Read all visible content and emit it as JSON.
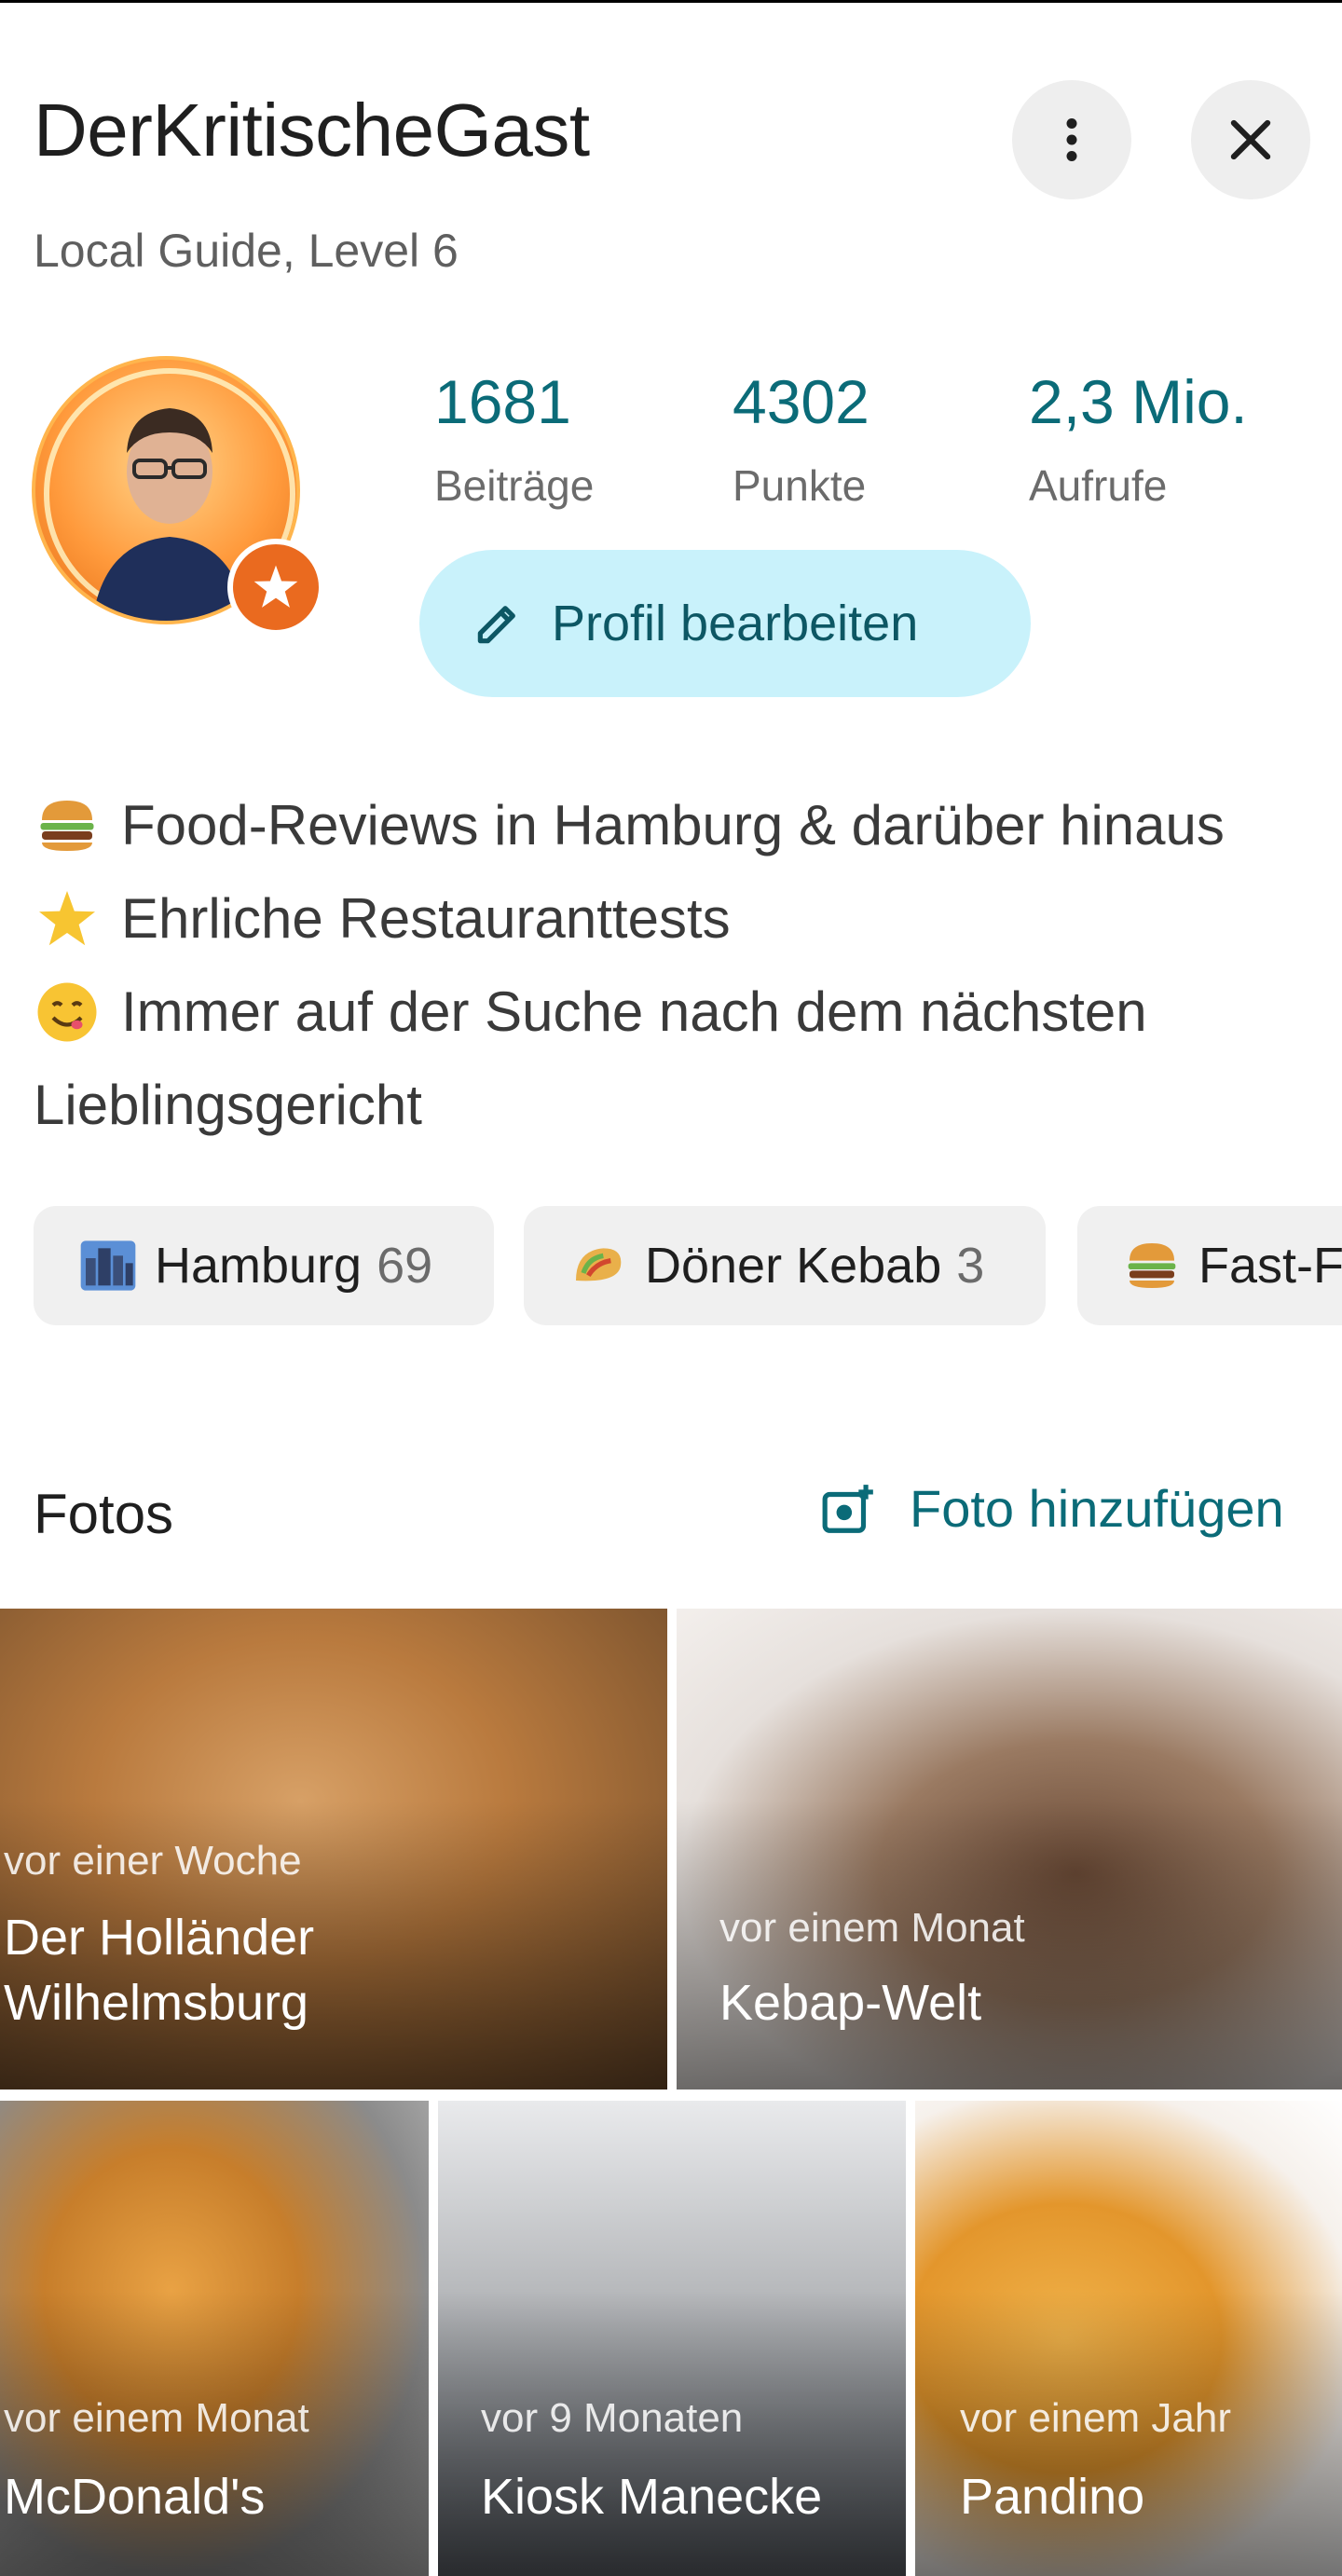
{
  "profile": {
    "name": "DerKritischeGast",
    "subtitle": "Local Guide, Level 6"
  },
  "actions": {
    "more": "more-vert-icon",
    "close": "close-icon"
  },
  "stats": [
    {
      "value": "1681",
      "label": "Beiträge"
    },
    {
      "value": "4302",
      "label": "Punkte"
    },
    {
      "value": "2,3 Mio.",
      "label": "Aufrufe"
    }
  ],
  "edit_profile": {
    "label": "Profil bearbeiten",
    "icon": "pencil-icon"
  },
  "bio": [
    {
      "emoji": "burger",
      "text": "Food-Reviews in Hamburg & darüber hinaus"
    },
    {
      "emoji": "star",
      "text": "Ehrliche Restauranttests"
    },
    {
      "emoji": "yum-face",
      "text": "Immer auf der Suche nach dem nächsten"
    },
    {
      "emoji": "",
      "text": "Lieblingsgericht"
    }
  ],
  "chips": [
    {
      "emoji": "city",
      "label": "Hamburg",
      "count": "69"
    },
    {
      "emoji": "taco",
      "label": "Döner Kebab",
      "count": "3"
    },
    {
      "emoji": "burger",
      "label": "Fast-F",
      "count": ""
    }
  ],
  "photos_section": {
    "title": "Fotos",
    "add_label": "Foto hinzufügen"
  },
  "photos": [
    {
      "time": "vor einer Woche",
      "place_line1": "Der Holländer",
      "place_line2": "Wilhelmsburg"
    },
    {
      "time": "vor einem Monat",
      "place_line1": "Kebap-Welt",
      "place_line2": ""
    },
    {
      "time": "vor einem Monat",
      "place_line1": "McDonald's",
      "place_line2": ""
    },
    {
      "time": "vor 9 Monaten",
      "place_line1": "Kiosk Manecke",
      "place_line2": ""
    },
    {
      "time": "vor einem Jahr",
      "place_line1": "Pandino",
      "place_line2": ""
    }
  ],
  "colors": {
    "accent": "#0b6b78",
    "edit_button_bg": "#c9f2fb",
    "badge": "#ea6a1f"
  }
}
